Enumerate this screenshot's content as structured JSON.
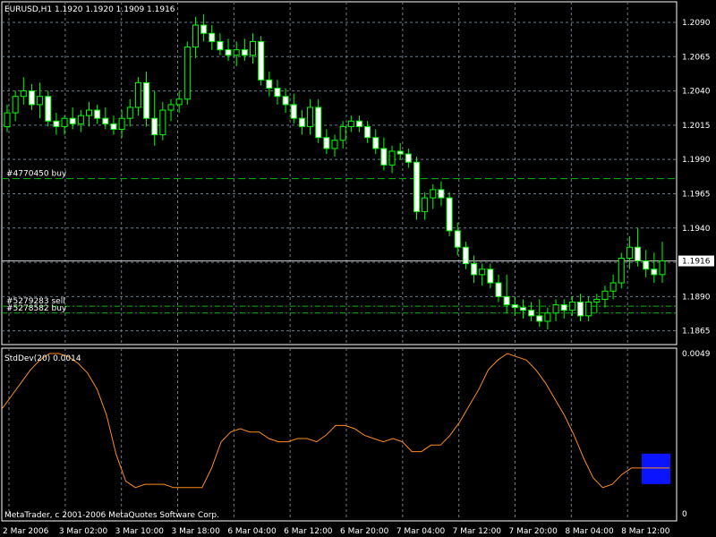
{
  "header": {
    "symbol_line": "EURUSD,H1  1.1920 1.1920 1.1909 1.1916"
  },
  "chart_data": [
    {
      "type": "candlestick",
      "title": "EURUSD,H1  1.1920 1.1920 1.1909 1.1916",
      "ylim": [
        1.1855,
        1.2105
      ],
      "y_ticks": [
        "1.2090",
        "1.2065",
        "1.2040",
        "1.2015",
        "1.1990",
        "1.1965",
        "1.1940",
        "1.1915",
        "1.1890",
        "1.1865"
      ],
      "current_price": "1.1916",
      "grid": true,
      "colors": {
        "up": "#000000",
        "down": "#ffffff",
        "wick": "#00ff00",
        "grid": "#6b7b8a",
        "price_line": "#c0c0c0",
        "order_line": "#00c000"
      },
      "orders": [
        {
          "label": "#4770450 buy",
          "price": 1.1976
        },
        {
          "label": "#5279283 sell",
          "price": 1.1883
        },
        {
          "label": "#5278582 buy",
          "price": 1.1878
        }
      ],
      "candles": [
        [
          1.2014,
          1.203,
          1.201,
          1.2024
        ],
        [
          1.2024,
          1.204,
          1.2018,
          1.2036
        ],
        [
          1.2036,
          1.205,
          1.203,
          1.204
        ],
        [
          1.204,
          1.2045,
          1.2026,
          1.203
        ],
        [
          1.203,
          1.2046,
          1.202,
          1.2036
        ],
        [
          1.2036,
          1.204,
          1.2014,
          1.2018
        ],
        [
          1.2018,
          1.2024,
          1.2008,
          1.2014
        ],
        [
          1.2014,
          1.2022,
          1.2008,
          1.202
        ],
        [
          1.202,
          1.2028,
          1.2012,
          1.2016
        ],
        [
          1.2016,
          1.2026,
          1.201,
          1.2022
        ],
        [
          1.2022,
          1.2032,
          1.2014,
          1.2026
        ],
        [
          1.2026,
          1.203,
          1.2016,
          1.202
        ],
        [
          1.202,
          1.2028,
          1.2012,
          1.2016
        ],
        [
          1.2016,
          1.2022,
          1.2008,
          1.2012
        ],
        [
          1.2012,
          1.2026,
          1.2006,
          1.202
        ],
        [
          1.202,
          1.2034,
          1.2014,
          1.2028
        ],
        [
          1.2028,
          1.205,
          1.2022,
          1.2046
        ],
        [
          1.2046,
          1.2054,
          1.2014,
          1.202
        ],
        [
          1.202,
          1.204,
          1.2,
          1.2008
        ],
        [
          1.2008,
          1.2032,
          1.2004,
          1.2026
        ],
        [
          1.2026,
          1.2034,
          1.2018,
          1.203
        ],
        [
          1.203,
          1.204,
          1.2024,
          1.2034
        ],
        [
          1.2034,
          1.2076,
          1.203,
          1.2072
        ],
        [
          1.2072,
          1.2094,
          1.2064,
          1.2088
        ],
        [
          1.2088,
          1.2096,
          1.2076,
          1.2082
        ],
        [
          1.2082,
          1.2088,
          1.207,
          1.2076
        ],
        [
          1.2076,
          1.2082,
          1.2066,
          1.207
        ],
        [
          1.207,
          1.2078,
          1.2062,
          1.2066
        ],
        [
          1.2066,
          1.2076,
          1.2058,
          1.207
        ],
        [
          1.207,
          1.2078,
          1.2062,
          1.2066
        ],
        [
          1.2066,
          1.2082,
          1.206,
          1.2076
        ],
        [
          1.2076,
          1.208,
          1.2044,
          1.2048
        ],
        [
          1.2048,
          1.2054,
          1.2036,
          1.2042
        ],
        [
          1.2042,
          1.2048,
          1.203,
          1.2036
        ],
        [
          1.2036,
          1.2042,
          1.2024,
          1.203
        ],
        [
          1.203,
          1.2038,
          1.2016,
          1.202
        ],
        [
          1.202,
          1.2026,
          1.2008,
          1.2014
        ],
        [
          1.2014,
          1.2034,
          1.2008,
          1.2028
        ],
        [
          1.2028,
          1.2034,
          1.2002,
          1.2006
        ],
        [
          1.2006,
          1.2012,
          1.1994,
          1.1998
        ],
        [
          1.1998,
          1.2008,
          1.1992,
          1.2004
        ],
        [
          1.2004,
          1.2018,
          1.1998,
          1.2014
        ],
        [
          1.2014,
          1.2022,
          1.201,
          1.2018
        ],
        [
          1.2018,
          1.2022,
          1.201,
          1.2014
        ],
        [
          1.2014,
          1.2018,
          1.2002,
          1.2006
        ],
        [
          1.2006,
          1.2012,
          1.1994,
          1.1998
        ],
        [
          1.1998,
          1.2006,
          1.1982,
          1.1986
        ],
        [
          1.1986,
          1.2,
          1.198,
          1.1996
        ],
        [
          1.1996,
          1.2002,
          1.199,
          1.1994
        ],
        [
          1.1994,
          1.1998,
          1.1984,
          1.1988
        ],
        [
          1.1988,
          1.1992,
          1.1946,
          1.1952
        ],
        [
          1.1952,
          1.1966,
          1.1946,
          1.1962
        ],
        [
          1.1962,
          1.1972,
          1.1954,
          1.1968
        ],
        [
          1.1968,
          1.1974,
          1.1956,
          1.1962
        ],
        [
          1.1962,
          1.1966,
          1.1934,
          1.1938
        ],
        [
          1.1938,
          1.1944,
          1.192,
          1.1926
        ],
        [
          1.1926,
          1.193,
          1.191,
          1.1914
        ],
        [
          1.1914,
          1.192,
          1.19,
          1.1906
        ],
        [
          1.1906,
          1.1914,
          1.1898,
          1.191
        ],
        [
          1.191,
          1.1914,
          1.1896,
          1.19
        ],
        [
          1.19,
          1.1906,
          1.1886,
          1.189
        ],
        [
          1.189,
          1.1906,
          1.1878,
          1.1884
        ],
        [
          1.1884,
          1.189,
          1.1876,
          1.1882
        ],
        [
          1.1882,
          1.1888,
          1.1874,
          1.188
        ],
        [
          1.188,
          1.1886,
          1.1872,
          1.1876
        ],
        [
          1.1876,
          1.1888,
          1.1868,
          1.1872
        ],
        [
          1.1872,
          1.1882,
          1.1866,
          1.1878
        ],
        [
          1.1878,
          1.1888,
          1.1872,
          1.1884
        ],
        [
          1.1884,
          1.1888,
          1.1874,
          1.188
        ],
        [
          1.188,
          1.189,
          1.1876,
          1.1886
        ],
        [
          1.1886,
          1.1892,
          1.1872,
          1.1876
        ],
        [
          1.1876,
          1.189,
          1.1872,
          1.1886
        ],
        [
          1.1886,
          1.1892,
          1.1878,
          1.1888
        ],
        [
          1.1888,
          1.1898,
          1.1882,
          1.1894
        ],
        [
          1.1894,
          1.1906,
          1.1888,
          1.19
        ],
        [
          1.19,
          1.1922,
          1.1896,
          1.1918
        ],
        [
          1.1918,
          1.1934,
          1.191,
          1.1926
        ],
        [
          1.1926,
          1.194,
          1.1912,
          1.1916
        ],
        [
          1.1916,
          1.1924,
          1.1904,
          1.191
        ],
        [
          1.191,
          1.1922,
          1.19,
          1.1906
        ],
        [
          1.1906,
          1.193,
          1.19,
          1.1916
        ]
      ]
    },
    {
      "type": "line",
      "title": "StdDev(20) 0.0014",
      "ylim": [
        0,
        0.0049
      ],
      "y_ticks": [
        "0.0049",
        "0"
      ],
      "color": "#ff8c1a",
      "values": [
        0.0032,
        0.0036,
        0.004,
        0.0044,
        0.0047,
        0.0049,
        0.0049,
        0.0048,
        0.0046,
        0.0043,
        0.0038,
        0.003,
        0.0018,
        0.001,
        0.0008,
        0.0009,
        0.0009,
        0.0009,
        0.0008,
        0.0008,
        0.0008,
        0.0008,
        0.0014,
        0.0022,
        0.0025,
        0.0026,
        0.0025,
        0.0025,
        0.0023,
        0.0022,
        0.0022,
        0.0023,
        0.0023,
        0.0022,
        0.0024,
        0.0027,
        0.0027,
        0.0026,
        0.0024,
        0.0023,
        0.0022,
        0.0023,
        0.0022,
        0.0019,
        0.0019,
        0.0021,
        0.0021,
        0.0024,
        0.0028,
        0.0033,
        0.0038,
        0.0044,
        0.0047,
        0.0049,
        0.0048,
        0.0047,
        0.0044,
        0.004,
        0.0035,
        0.003,
        0.0024,
        0.0017,
        0.0011,
        0.0008,
        0.0009,
        0.0012,
        0.0014,
        0.0014,
        0.0014,
        0.0014,
        0.0014
      ],
      "highlight": {
        "color": "#0a14ff"
      }
    }
  ],
  "x_axis": {
    "labels": [
      "2 Mar 2006",
      "3 Mar 02:00",
      "3 Mar 10:00",
      "3 Mar 18:00",
      "6 Mar 04:00",
      "6 Mar 12:00",
      "6 Mar 20:00",
      "7 Mar 04:00",
      "7 Mar 12:00",
      "7 Mar 20:00",
      "8 Mar 04:00",
      "8 Mar 12:00"
    ]
  },
  "footer": {
    "copyright": "MetaTrader, c 2001-2006 MetaQuotes Software Corp."
  }
}
